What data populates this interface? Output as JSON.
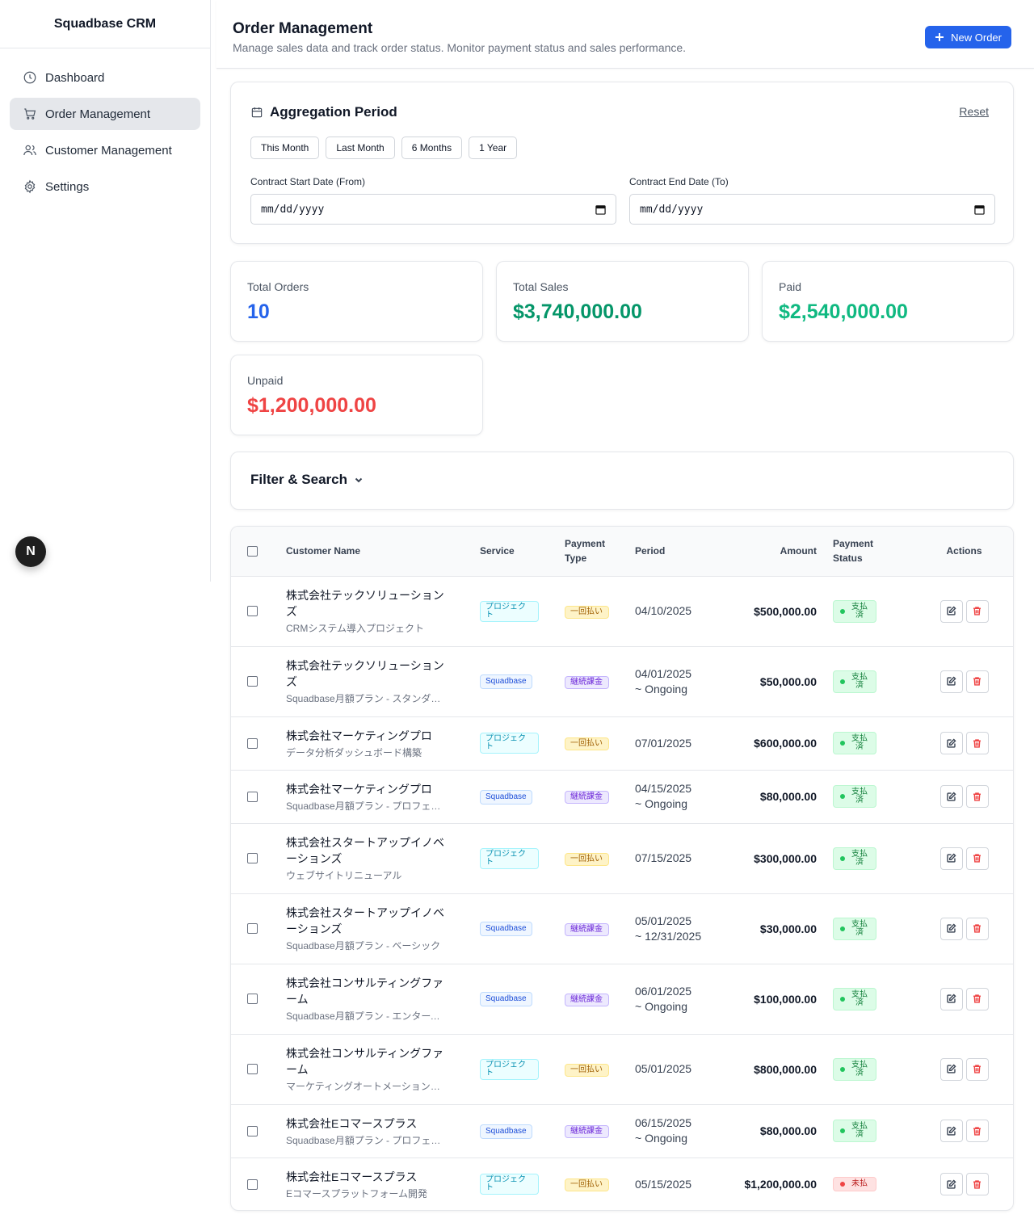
{
  "app": {
    "brand": "Squadbase CRM",
    "n_badge": "N"
  },
  "sidebar": {
    "items": [
      {
        "label": "Dashboard",
        "icon": "clock-icon"
      },
      {
        "label": "Order Management",
        "icon": "cart-icon",
        "active": true
      },
      {
        "label": "Customer Management",
        "icon": "users-icon"
      },
      {
        "label": "Settings",
        "icon": "gear-icon"
      }
    ]
  },
  "header": {
    "title": "Order Management",
    "subtitle": "Manage sales data and track order status. Monitor payment status and sales performance.",
    "new_order": "New Order"
  },
  "aggregation": {
    "title": "Aggregation Period",
    "reset": "Reset",
    "chips": [
      "This Month",
      "Last Month",
      "6 Months",
      "1 Year"
    ],
    "start_label": "Contract Start Date (From)",
    "end_label": "Contract End Date (To)",
    "start_value": "mm/dd/yyyy",
    "end_value": "mm/dd/yyyy"
  },
  "stats": {
    "total_orders": {
      "label": "Total Orders",
      "value": "10",
      "color": "#2563eb"
    },
    "total_sales": {
      "label": "Total Sales",
      "value": "$3,740,000.00",
      "color": "#059669"
    },
    "paid": {
      "label": "Paid",
      "value": "$2,540,000.00",
      "color": "#10b981"
    },
    "unpaid": {
      "label": "Unpaid",
      "value": "$1,200,000.00",
      "color": "#ef4444"
    }
  },
  "filter": {
    "title": "Filter & Search"
  },
  "table": {
    "headers": {
      "customer": "Customer Name",
      "service": "Service",
      "payment_type_1": "Payment",
      "payment_type_2": "Type",
      "period": "Period",
      "amount": "Amount",
      "payment_status_1": "Payment",
      "payment_status_2": "Status",
      "actions": "Actions"
    },
    "rows": [
      {
        "name": "株式会社テックソリューションズ",
        "sub": "CRMシステム導入プロジェクト",
        "service": "プロジェクト",
        "service_kind": "proj",
        "ptype": "一回払い",
        "ptype_kind": "once",
        "period1": "04/10/2025",
        "period2": "",
        "amount": "$500,000.00",
        "status": "支払済",
        "status_kind": "paid"
      },
      {
        "name": "株式会社テックソリューションズ",
        "sub": "Squadbase月額プラン - スタンダード",
        "service": "Squadbase",
        "service_kind": "sq",
        "ptype": "継続課金",
        "ptype_kind": "sub",
        "period1": "04/01/2025",
        "period2": "~ Ongoing",
        "amount": "$50,000.00",
        "status": "支払済",
        "status_kind": "paid"
      },
      {
        "name": "株式会社マーケティングプロ",
        "sub": "データ分析ダッシュボード構築",
        "service": "プロジェクト",
        "service_kind": "proj",
        "ptype": "一回払い",
        "ptype_kind": "once",
        "period1": "07/01/2025",
        "period2": "",
        "amount": "$600,000.00",
        "status": "支払済",
        "status_kind": "paid"
      },
      {
        "name": "株式会社マーケティングプロ",
        "sub": "Squadbase月額プラン - プロフェッショナル",
        "service": "Squadbase",
        "service_kind": "sq",
        "ptype": "継続課金",
        "ptype_kind": "sub",
        "period1": "04/15/2025",
        "period2": "~ Ongoing",
        "amount": "$80,000.00",
        "status": "支払済",
        "status_kind": "paid"
      },
      {
        "name": "株式会社スタートアップイノベーションズ",
        "sub": "ウェブサイトリニューアル",
        "service": "プロジェクト",
        "service_kind": "proj",
        "ptype": "一回払い",
        "ptype_kind": "once",
        "period1": "07/15/2025",
        "period2": "",
        "amount": "$300,000.00",
        "status": "支払済",
        "status_kind": "paid"
      },
      {
        "name": "株式会社スタートアップイノベーションズ",
        "sub": "Squadbase月額プラン - ベーシック",
        "service": "Squadbase",
        "service_kind": "sq",
        "ptype": "継続課金",
        "ptype_kind": "sub",
        "period1": "05/01/2025",
        "period2": "~ 12/31/2025",
        "amount": "$30,000.00",
        "status": "支払済",
        "status_kind": "paid"
      },
      {
        "name": "株式会社コンサルティングファーム",
        "sub": "Squadbase月額プラン - エンタープライズ",
        "service": "Squadbase",
        "service_kind": "sq",
        "ptype": "継続課金",
        "ptype_kind": "sub",
        "period1": "06/01/2025",
        "period2": "~ Ongoing",
        "amount": "$100,000.00",
        "status": "支払済",
        "status_kind": "paid"
      },
      {
        "name": "株式会社コンサルティングファーム",
        "sub": "マーケティングオートメーション導入",
        "service": "プロジェクト",
        "service_kind": "proj",
        "ptype": "一回払い",
        "ptype_kind": "once",
        "period1": "05/01/2025",
        "period2": "",
        "amount": "$800,000.00",
        "status": "支払済",
        "status_kind": "paid"
      },
      {
        "name": "株式会社Eコマースプラス",
        "sub": "Squadbase月額プラン - プロフェッショナル",
        "service": "Squadbase",
        "service_kind": "sq",
        "ptype": "継続課金",
        "ptype_kind": "sub",
        "period1": "06/15/2025",
        "period2": "~ Ongoing",
        "amount": "$80,000.00",
        "status": "支払済",
        "status_kind": "paid"
      },
      {
        "name": "株式会社Eコマースプラス",
        "sub": "Eコマースプラットフォーム開発",
        "service": "プロジェクト",
        "service_kind": "proj",
        "ptype": "一回払い",
        "ptype_kind": "once",
        "period1": "05/15/2025",
        "period2": "",
        "amount": "$1,200,000.00",
        "status": "未払",
        "status_kind": "unpaid"
      }
    ]
  }
}
